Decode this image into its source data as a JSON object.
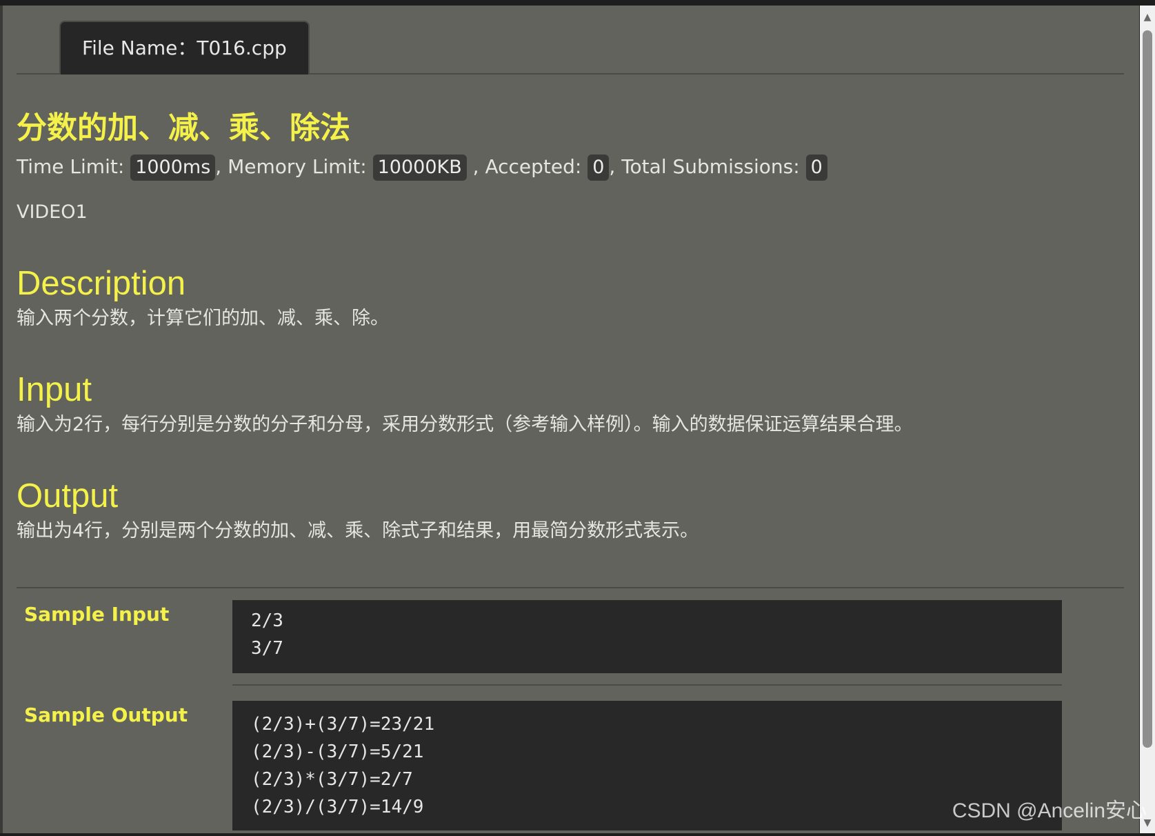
{
  "tab": {
    "file_name": "File Name：T016.cpp"
  },
  "problem": {
    "title": "分数的加、减、乘、除法",
    "limits": {
      "time_label": "Time Limit:",
      "time_value": "1000ms",
      "memory_label": ", Memory Limit:",
      "memory_value": "10000KB",
      "accepted_label": ", Accepted:",
      "accepted_value": "0",
      "submissions_label": ", Total Submissions:",
      "submissions_value": "0"
    },
    "video": "VIDEO1"
  },
  "sections": {
    "description": {
      "title": "Description",
      "text": "输入两个分数，计算它们的加、减、乘、除。"
    },
    "input": {
      "title": "Input",
      "text": "输入为2行，每行分别是分数的分子和分母，采用分数形式（参考输入样例）。输入的数据保证运算结果合理。"
    },
    "output": {
      "title": "Output",
      "text": "输出为4行，分别是两个分数的加、减、乘、除式子和结果，用最简分数形式表示。"
    }
  },
  "samples": {
    "input_label": "Sample Input",
    "input_lines": [
      "2/3",
      "3/7"
    ],
    "output_label": "Sample Output",
    "output_lines": [
      "(2/3)+(3/7)=23/21",
      "(2/3)-(3/7)=5/21",
      "(2/3)*(3/7)=2/7",
      "(2/3)/(3/7)=14/9"
    ]
  },
  "scrollbar": {
    "up_icon": "▲",
    "down_icon": "▼"
  },
  "watermark": "CSDN @Ancelin安心"
}
